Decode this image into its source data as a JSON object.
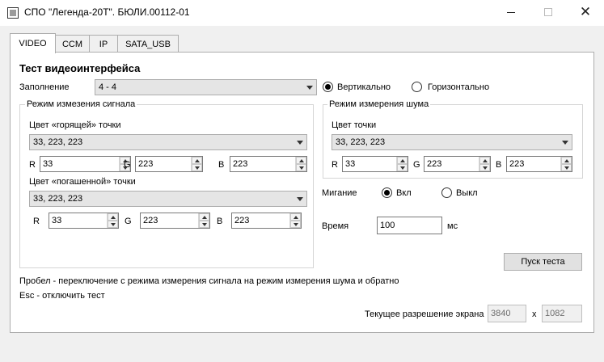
{
  "window": {
    "title": "СПО \"Легенда-20Т\". БЮЛИ.00112-01"
  },
  "tabs": [
    {
      "label": "VIDEO",
      "active": true
    },
    {
      "label": "CCM",
      "active": false
    },
    {
      "label": "IP",
      "active": false
    },
    {
      "label": "SATA_USB",
      "active": false
    }
  ],
  "video": {
    "heading": "Тест видеоинтерфейса",
    "fill_label": "Заполнение",
    "fill_value": "4 - 4",
    "orientation": {
      "vertical_label": "Вертикально",
      "horizontal_label": "Горизонтально",
      "selected": "vertical"
    },
    "signal_group": {
      "title": "Режим измезения сигнала",
      "hot_pixel": {
        "label": "Цвет «горящей» точки",
        "combo_value": "33, 223, 223",
        "r_label": "R",
        "r": "33",
        "g_label": "G",
        "g": "223",
        "b_label": "B",
        "b": "223"
      },
      "dead_pixel": {
        "label": "Цвет «погашенной» точки",
        "combo_value": "33, 223, 223",
        "r_label": "R",
        "r": "33",
        "g_label": "G",
        "g": "223",
        "b_label": "B",
        "b": "223"
      }
    },
    "noise_group": {
      "title": "Режим измерения шума",
      "pixel": {
        "label": "Цвет точки",
        "combo_value": "33, 223, 223",
        "r_label": "R",
        "r": "33",
        "g_label": "G",
        "g": "223",
        "b_label": "B",
        "b": "223"
      }
    },
    "blink": {
      "label": "Мигание",
      "on_label": "Вкл",
      "off_label": "Выкл",
      "selected": "on"
    },
    "time": {
      "label": "Время",
      "value": "100",
      "unit": "мс"
    },
    "start_button": "Пуск теста",
    "hint_space": "Пробел - переключение с режима измерения сигнала на режим измерения шума и обратно",
    "hint_esc": "Esc - отключить тест",
    "resolution": {
      "label": "Текущее разрешение экрана",
      "width": "3840",
      "separator": "x",
      "height": "1082"
    }
  }
}
